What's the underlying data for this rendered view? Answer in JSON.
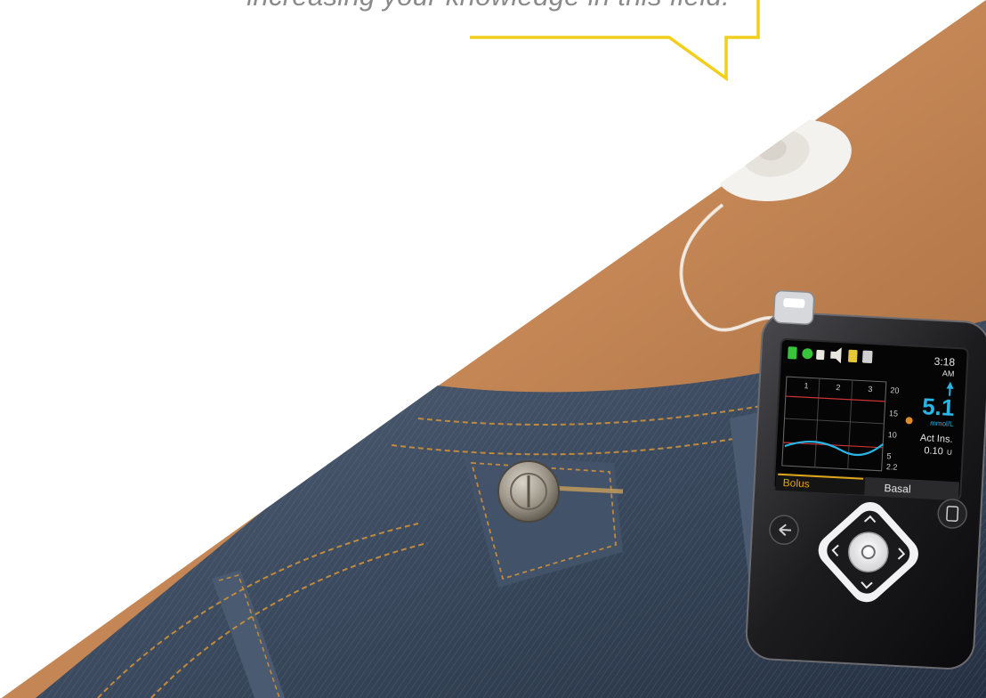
{
  "caption": {
    "text": "increasing your knowledge in this field."
  },
  "pump": {
    "time": "3:18",
    "ampm": "AM",
    "glucose_value": "5.1",
    "glucose_unit": "mmol/L",
    "active_insulin_label": "Act Ins.",
    "active_insulin_value": "0.10",
    "active_insulin_unit": "U",
    "graph_x_ticks": [
      "1",
      "2",
      "3"
    ],
    "graph_y_ticks": [
      "20",
      "15",
      "10",
      "5",
      "2.2"
    ],
    "tab_bolus": "Bolus",
    "tab_basal": "Basal"
  },
  "colors": {
    "speech_bubble": "#f2cf1a",
    "glucose_value": "#29b6e6",
    "tab_active": "#e0a619",
    "denim": "#3b4a5e",
    "skin": "#c98a58"
  }
}
